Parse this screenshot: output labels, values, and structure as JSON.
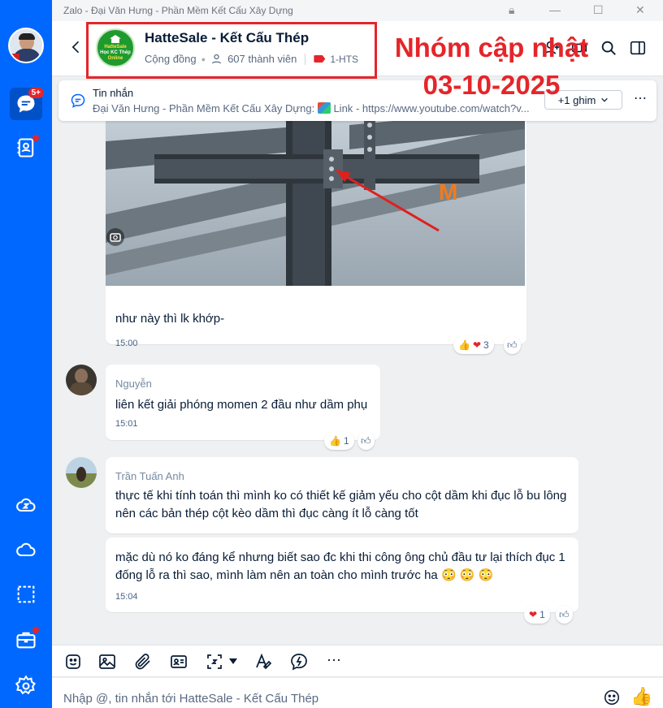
{
  "window": {
    "title": "Zalo - Đại Văn Hưng - Phần Mềm Kết Cấu Xây Dựng"
  },
  "sidebar": {
    "messages_badge": "5+"
  },
  "header": {
    "group_name": "HatteSale - Kết Cấu Thép",
    "group_type": "Cộng đồng",
    "members": "607 thành viên",
    "tag": "1-HTS",
    "logo_line1": "HatteSale",
    "logo_line2": "Học KC Thép",
    "logo_line3": "Online"
  },
  "annotation": {
    "line1": "Nhóm cập nhật",
    "line2": "03-10-2025"
  },
  "pinned": {
    "title": "Tin nhắn",
    "preview": "Đại Văn Hưng - Phần Mềm Kết Cấu Xây Dựng:",
    "link_label": "Link",
    "url": "https://www.youtube.com/watch?v...",
    "pin_more": "+1 ghim"
  },
  "messages": [
    {
      "text": "như này thì lk khớp-",
      "time": "15:00",
      "reactions": "3"
    },
    {
      "sender": "Nguyễn",
      "text": "liên kết giải phóng momen 2 đầu như dầm phụ",
      "time": "15:01",
      "reactions": "1"
    },
    {
      "sender": "Trần Tuấn Anh",
      "text": "thực tế khi tính toán thì mình ko có thiết kế giảm yếu cho cột dầm khi đục lỗ bu lông nên các bản thép cột kèo dầm thì đục càng ít lỗ càng tốt"
    },
    {
      "text": "mặc dù nó ko đáng kể nhưng biết sao đc khi thi công ông chủ đầu tư lại thích đục 1 đống lỗ ra thì sao, mình làm nên an toàn cho mình trước ha",
      "emoji": "😳 😳 😳",
      "time": "15:04",
      "reactions": "1"
    }
  ],
  "image": {
    "watermark": "M"
  },
  "composer": {
    "placeholder": "Nhập @, tin nhắn tới HatteSale - Kết Cấu Thép"
  },
  "colors": {
    "accent": "#0068ff",
    "annotation": "#e5252a",
    "tag": "#e5252a"
  }
}
